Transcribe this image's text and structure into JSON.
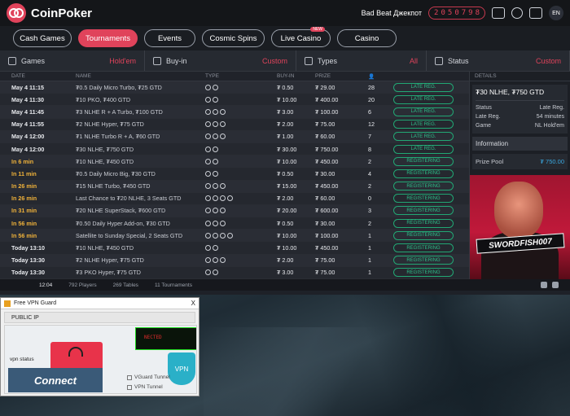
{
  "app": {
    "brand": "CoinPoker",
    "bad_beat_label": "Bad Beat Джекпот",
    "jackpot_digits": [
      "2",
      "0",
      "5",
      "0",
      "7",
      "9",
      "8"
    ],
    "lang": "EN",
    "accent": "#e0435b"
  },
  "tabs": [
    {
      "label": "Cash Games",
      "active": false,
      "new": ""
    },
    {
      "label": "Tournaments",
      "active": true,
      "new": ""
    },
    {
      "label": "Events",
      "active": false,
      "new": ""
    },
    {
      "label": "Cosmic Spins",
      "active": false,
      "new": ""
    },
    {
      "label": "Live Casino",
      "active": false,
      "new": "NEW"
    },
    {
      "label": "Casino",
      "active": false,
      "new": ""
    }
  ],
  "filters": [
    {
      "label": "Games",
      "value": "Hold'em",
      "icon": "gamepad-icon"
    },
    {
      "label": "Buy-in",
      "value": "Custom",
      "icon": "coin-icon"
    },
    {
      "label": "Types",
      "value": "All",
      "icon": "types-icon"
    },
    {
      "label": "Status",
      "value": "Custom",
      "icon": "status-icon"
    }
  ],
  "table": {
    "headers": {
      "date": "DATE",
      "name": "NAME",
      "type": "TYPE",
      "buyin": "BUY-IN",
      "prize": "PRIZE",
      "players": "👤"
    },
    "rows": [
      {
        "date": "May 4 11:15",
        "name": "₮0.5 Daily Micro Turbo, ₮25 GTD",
        "buyin": "₮ 0.50",
        "prize": "₮ 29.00",
        "players": "28",
        "status": "LATE REG.",
        "soon": false,
        "icons": 2
      },
      {
        "date": "May 4 11:30",
        "name": "₮10 PKO, ₮400 GTD",
        "buyin": "₮ 10.00",
        "prize": "₮ 400.00",
        "players": "20",
        "status": "LATE REG.",
        "soon": false,
        "icons": 2
      },
      {
        "date": "May 4 11:45",
        "name": "₮3 NLHE R + A Turbo, ₮100 GTD",
        "buyin": "₮ 3.00",
        "prize": "₮ 100.00",
        "players": "6",
        "status": "LATE REG.",
        "soon": false,
        "icons": 3
      },
      {
        "date": "May 4 11:55",
        "name": "₮2 NLHE Hyper, ₮75 GTD",
        "buyin": "₮ 2.00",
        "prize": "₮ 75.00",
        "players": "12",
        "status": "LATE REG.",
        "soon": false,
        "icons": 3
      },
      {
        "date": "May 4 12:00",
        "name": "₮1 NLHE Turbo R + A, ₮60 GTD",
        "buyin": "₮ 1.00",
        "prize": "₮ 60.00",
        "players": "7",
        "status": "LATE REG.",
        "soon": false,
        "icons": 3
      },
      {
        "date": "May 4 12:00",
        "name": "₮30 NLHE, ₮750 GTD",
        "buyin": "₮ 30.00",
        "prize": "₮ 750.00",
        "players": "8",
        "status": "LATE REG.",
        "soon": false,
        "icons": 2
      },
      {
        "date": "In 6 min",
        "name": "₮10 NLHE, ₮450 GTD",
        "buyin": "₮ 10.00",
        "prize": "₮ 450.00",
        "players": "2",
        "status": "REGISTERING",
        "soon": true,
        "icons": 2
      },
      {
        "date": "In 11 min",
        "name": "₮0.5 Daily Micro Big, ₮30 GTD",
        "buyin": "₮ 0.50",
        "prize": "₮ 30.00",
        "players": "4",
        "status": "REGISTERING",
        "soon": true,
        "icons": 2
      },
      {
        "date": "In 26 min",
        "name": "₮15 NLHE Turbo, ₮450 GTD",
        "buyin": "₮ 15.00",
        "prize": "₮ 450.00",
        "players": "2",
        "status": "REGISTERING",
        "soon": true,
        "icons": 3
      },
      {
        "date": "In 26 min",
        "name": "Last Chance to ₮20 NLHE, 3 Seats GTD",
        "buyin": "₮ 2.00",
        "prize": "₮ 60.00",
        "players": "0",
        "status": "REGISTERING",
        "soon": true,
        "icons": 4
      },
      {
        "date": "In 31 min",
        "name": "₮20 NLHE SuperStack, ₮600 GTD",
        "buyin": "₮ 20.00",
        "prize": "₮ 600.00",
        "players": "3",
        "status": "REGISTERING",
        "soon": true,
        "icons": 3
      },
      {
        "date": "In 56 min",
        "name": "₮0.50 Daily Hyper Add-on, ₮30 GTD",
        "buyin": "₮ 0.50",
        "prize": "₮ 30.00",
        "players": "2",
        "status": "REGISTERING",
        "soon": true,
        "icons": 3
      },
      {
        "date": "In 56 min",
        "name": "Satellite to Sunday Special, 2 Seats GTD",
        "buyin": "₮ 10.00",
        "prize": "₮ 100.00",
        "players": "1",
        "status": "REGISTERING",
        "soon": true,
        "icons": 4
      },
      {
        "date": "Today 13:10",
        "name": "₮10 NLHE, ₮450 GTD",
        "buyin": "₮ 10.00",
        "prize": "₮ 450.00",
        "players": "1",
        "status": "REGISTERING",
        "soon": false,
        "icons": 2
      },
      {
        "date": "Today 13:30",
        "name": "₮2 NLHE Hyper, ₮75 GTD",
        "buyin": "₮ 2.00",
        "prize": "₮ 75.00",
        "players": "1",
        "status": "REGISTERING",
        "soon": false,
        "icons": 3
      },
      {
        "date": "Today 13:30",
        "name": "₮3 PKO Hyper, ₮75 GTD",
        "buyin": "₮ 3.00",
        "prize": "₮ 75.00",
        "players": "1",
        "status": "REGISTERING",
        "soon": false,
        "icons": 2
      }
    ]
  },
  "details": {
    "header": "DETAILS",
    "title": "₮30 NLHE, ₮750 GTD",
    "lines": [
      {
        "k": "Status",
        "v": "Late Reg."
      },
      {
        "k": "Late Reg.",
        "v": "54 minutes"
      },
      {
        "k": "Game",
        "v": "NL Hold'em"
      }
    ],
    "info_label": "Information",
    "prize_pool_label": "Prize Pool",
    "prize_pool_value": "₮ 750.00",
    "banner_tag": "SWORDFISH007"
  },
  "footer": {
    "time": "12:04",
    "players": "792 Players",
    "tables": "269 Tables",
    "tournaments": "11 Tournaments"
  },
  "vpn": {
    "title": "Free VPN Guard",
    "close": "X",
    "public_ip": "PUBLIC IP",
    "status_label": "vpn status",
    "connect": "Connect",
    "screen_text": "NECTED",
    "shield": "VPN",
    "opt1": "VGuard Tunnel",
    "opt2": "VPN Tunnel"
  }
}
